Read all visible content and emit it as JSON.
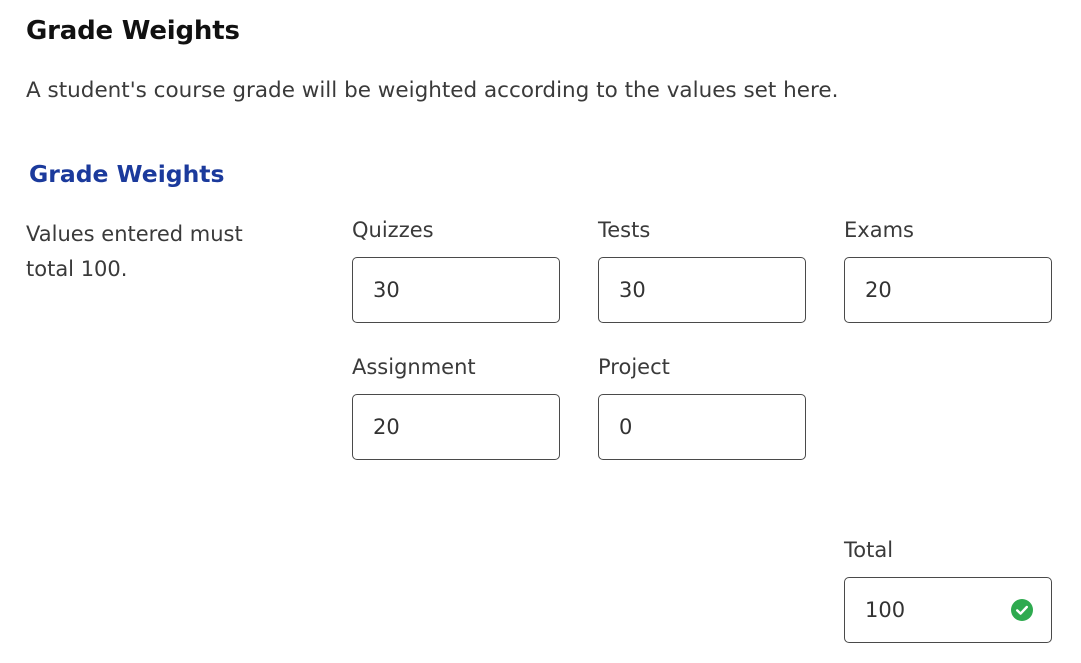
{
  "header": {
    "title": "Grade Weights",
    "description": "A student's course grade will be weighted according to the values set here."
  },
  "section": {
    "title": "Grade Weights",
    "hint": "Values entered must total 100."
  },
  "fields": {
    "quizzes": {
      "label": "Quizzes",
      "value": "30"
    },
    "tests": {
      "label": "Tests",
      "value": "30"
    },
    "exams": {
      "label": "Exams",
      "value": "20"
    },
    "assignment": {
      "label": "Assignment",
      "value": "20"
    },
    "project": {
      "label": "Project",
      "value": "0"
    }
  },
  "total": {
    "label": "Total",
    "value": "100",
    "status_icon": "check-circle-icon",
    "status_color": "#2eaa4f"
  }
}
